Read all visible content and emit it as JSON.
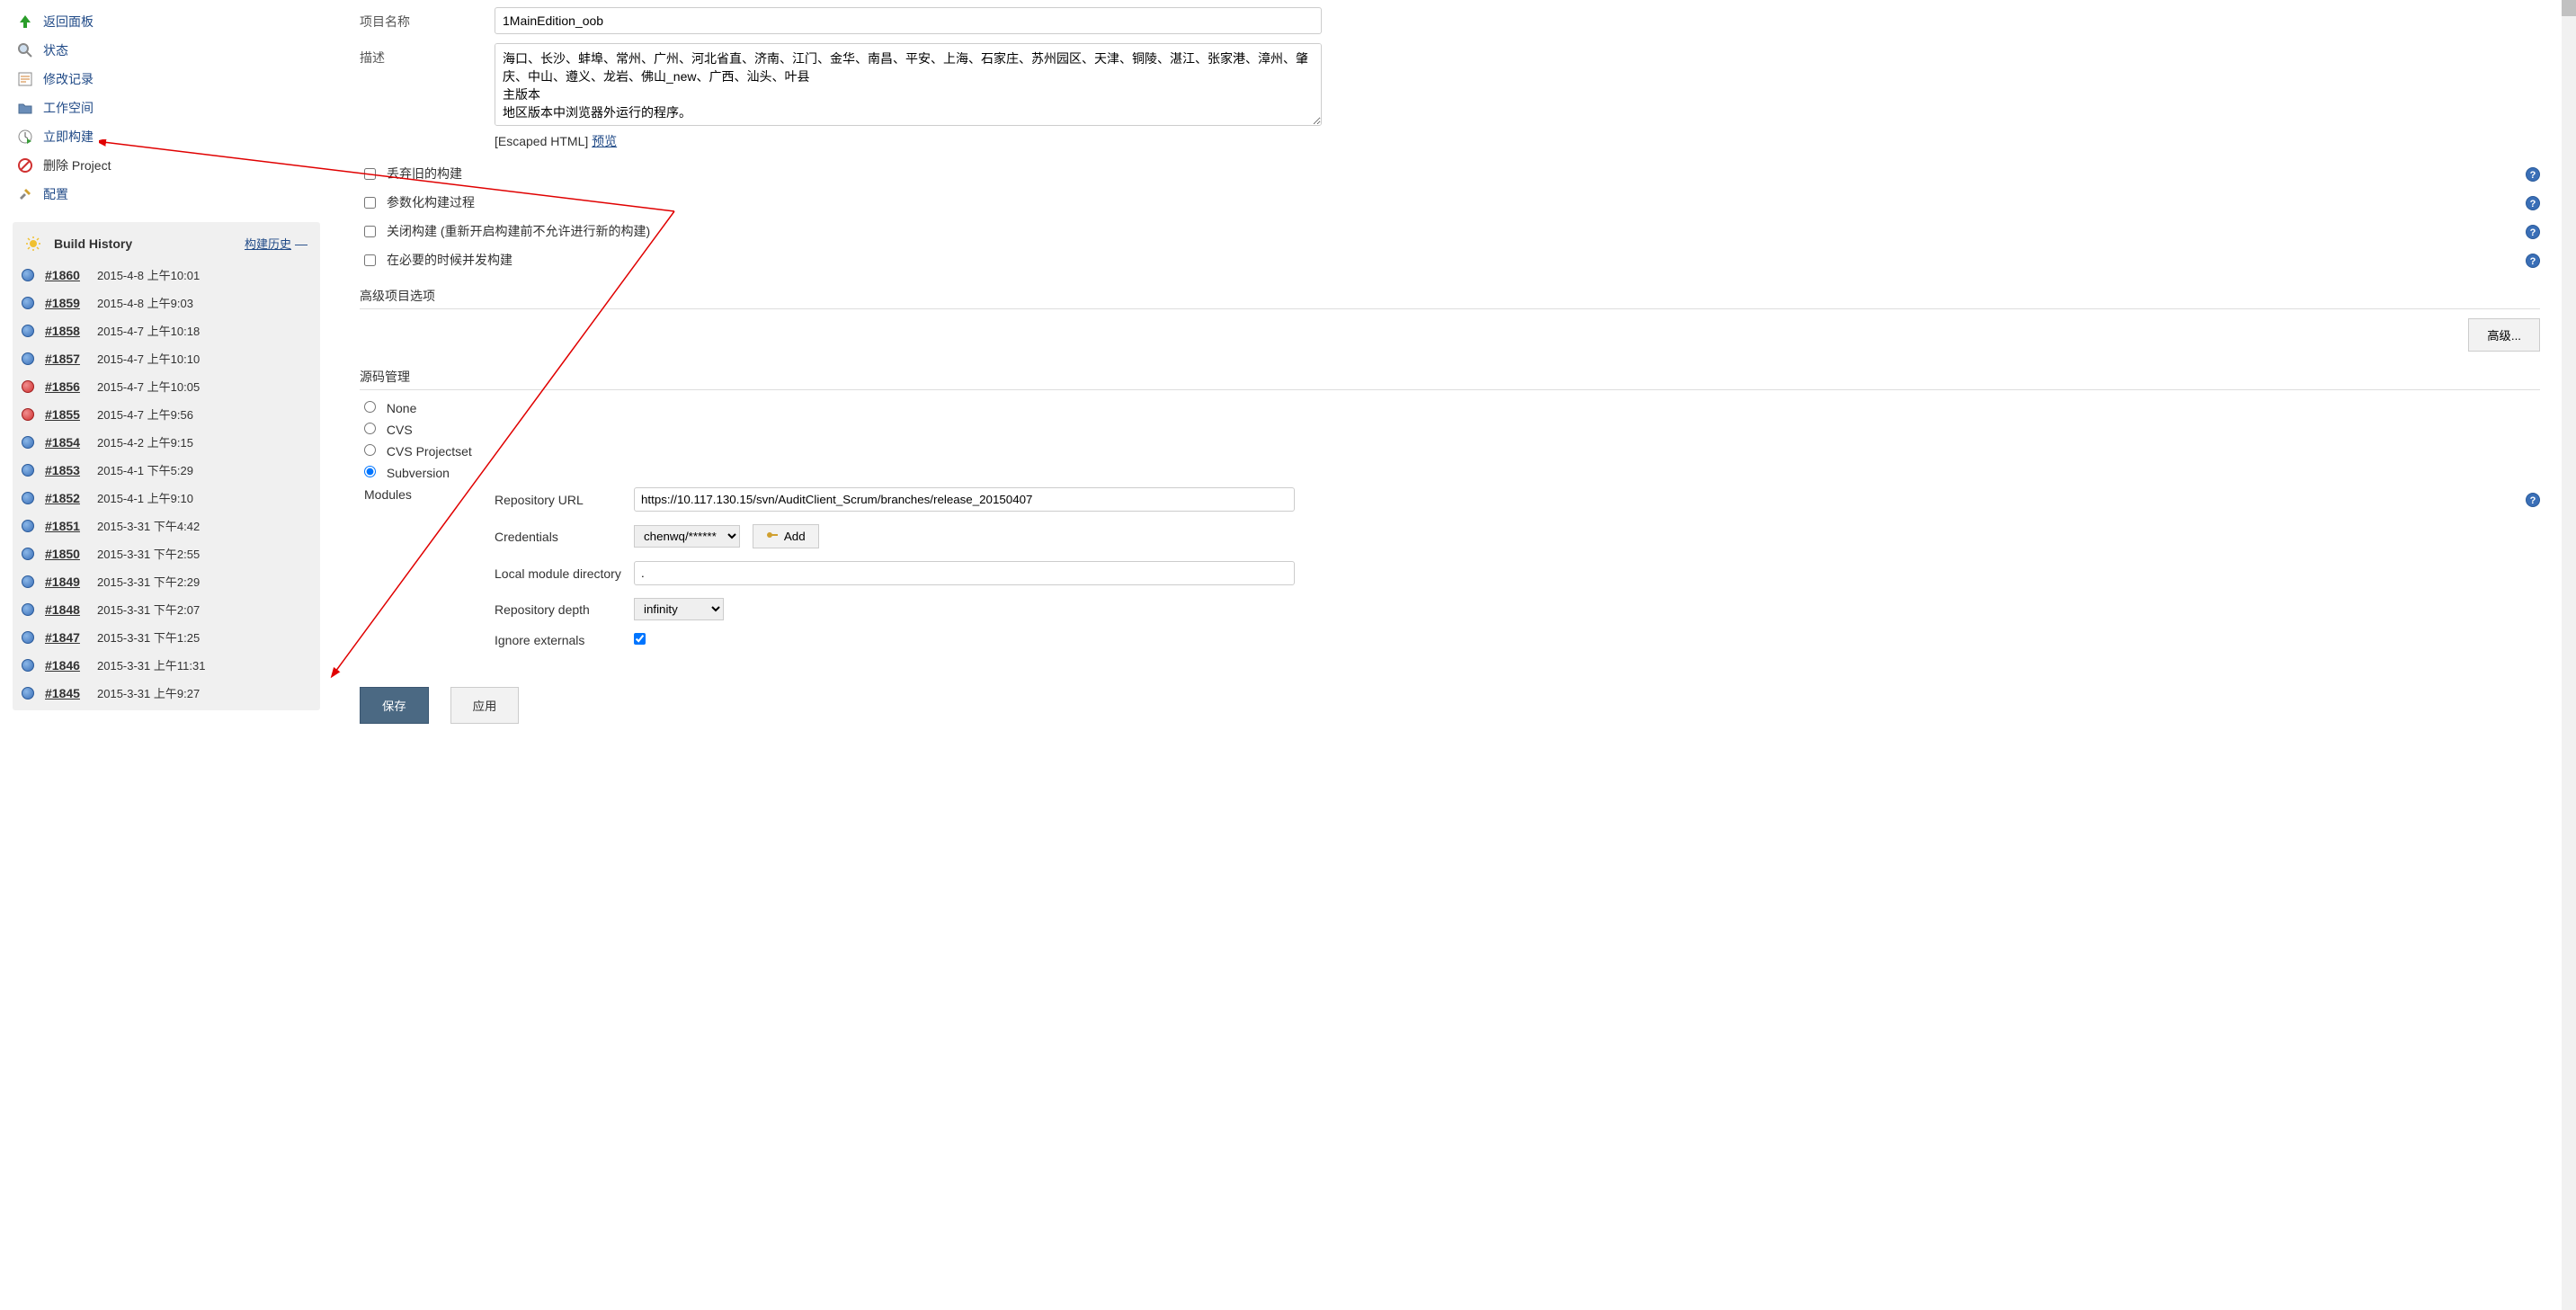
{
  "sidebar": {
    "nav": [
      {
        "label": "返回面板",
        "icon": "arrow-up"
      },
      {
        "label": "状态",
        "icon": "search"
      },
      {
        "label": "修改记录",
        "icon": "notes"
      },
      {
        "label": "工作空间",
        "icon": "folder"
      },
      {
        "label": "立即构建",
        "icon": "clock-play"
      },
      {
        "label": "删除 Project",
        "icon": "forbidden"
      },
      {
        "label": "配置",
        "icon": "tools"
      }
    ],
    "build_history": {
      "title": "Build History",
      "link": "构建历史",
      "items": [
        {
          "num": "#1860",
          "time": "2015-4-8 上午10:01",
          "status": "blue"
        },
        {
          "num": "#1859",
          "time": "2015-4-8 上午9:03",
          "status": "blue"
        },
        {
          "num": "#1858",
          "time": "2015-4-7 上午10:18",
          "status": "blue"
        },
        {
          "num": "#1857",
          "time": "2015-4-7 上午10:10",
          "status": "blue"
        },
        {
          "num": "#1856",
          "time": "2015-4-7 上午10:05",
          "status": "red"
        },
        {
          "num": "#1855",
          "time": "2015-4-7 上午9:56",
          "status": "red"
        },
        {
          "num": "#1854",
          "time": "2015-4-2 上午9:15",
          "status": "blue"
        },
        {
          "num": "#1853",
          "time": "2015-4-1 下午5:29",
          "status": "blue"
        },
        {
          "num": "#1852",
          "time": "2015-4-1 上午9:10",
          "status": "blue"
        },
        {
          "num": "#1851",
          "time": "2015-3-31 下午4:42",
          "status": "blue"
        },
        {
          "num": "#1850",
          "time": "2015-3-31 下午2:55",
          "status": "blue"
        },
        {
          "num": "#1849",
          "time": "2015-3-31 下午2:29",
          "status": "blue"
        },
        {
          "num": "#1848",
          "time": "2015-3-31 下午2:07",
          "status": "blue"
        },
        {
          "num": "#1847",
          "time": "2015-3-31 下午1:25",
          "status": "blue"
        },
        {
          "num": "#1846",
          "time": "2015-3-31 上午11:31",
          "status": "blue"
        },
        {
          "num": "#1845",
          "time": "2015-3-31 上午9:27",
          "status": "blue"
        }
      ]
    }
  },
  "form": {
    "project_name_label": "项目名称",
    "project_name_value": "1MainEdition_oob",
    "desc_label": "描述",
    "desc_value": "海口、长沙、蚌埠、常州、广州、河北省直、济南、江门、金华、南昌、平安、上海、石家庄、苏州园区、天津、铜陵、湛江、张家港、漳州、肇庆、中山、遵义、龙岩、佛山_new、广西、汕头、叶县\n主版本\n地区版本中浏览器外运行的程序。",
    "escaped_label": "[Escaped HTML] ",
    "preview_label": "预览",
    "checkboxes": [
      {
        "label": "丢弃旧的构建"
      },
      {
        "label": "参数化构建过程"
      },
      {
        "label": "关闭构建 (重新开启构建前不允许进行新的构建)"
      },
      {
        "label": "在必要的时候并发构建"
      }
    ],
    "adv_section": "高级项目选项",
    "adv_button": "高级...",
    "scm_section": "源码管理",
    "scm_options": [
      {
        "label": "None",
        "checked": false
      },
      {
        "label": "CVS",
        "checked": false
      },
      {
        "label": "CVS Projectset",
        "checked": false
      },
      {
        "label": "Subversion",
        "checked": true
      }
    ],
    "modules_label": "Modules",
    "repo_url_label": "Repository URL",
    "repo_url_value": "https://10.117.130.15/svn/AuditClient_Scrum/branches/release_20150407",
    "credentials_label": "Credentials",
    "credentials_value": "chenwq/******",
    "add_button": "Add",
    "local_dir_label": "Local module directory",
    "local_dir_value": ".",
    "depth_label": "Repository depth",
    "depth_value": "infinity",
    "ignore_ext_label": "Ignore externals",
    "save_button": "保存",
    "apply_button": "应用"
  }
}
